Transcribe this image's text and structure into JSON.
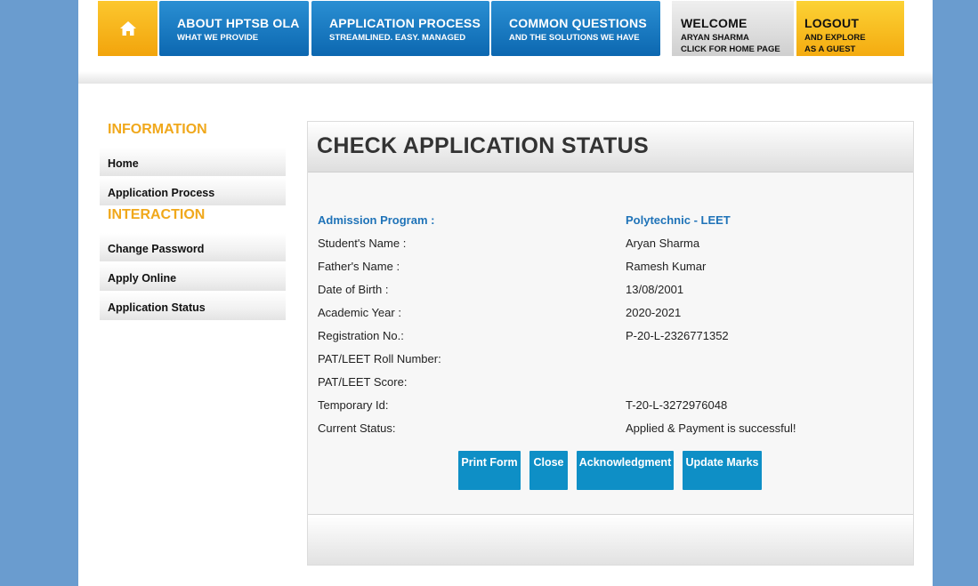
{
  "nav": {
    "about": {
      "title": "ABOUT HPTSB OLA",
      "subtitle": "WHAT WE PROVIDE"
    },
    "process": {
      "title": "APPLICATION PROCESS",
      "subtitle": "STREAMLINED. EASY. MANAGED"
    },
    "questions": {
      "title": "COMMON QUESTIONS",
      "subtitle": "AND THE SOLUTIONS WE HAVE"
    },
    "welcome": {
      "title": "WELCOME",
      "line1": "ARYAN SHARMA",
      "line2": "CLICK FOR HOME PAGE"
    },
    "logout": {
      "title": "LOGOUT",
      "line1": "AND EXPLORE",
      "line2": "AS A GUEST"
    },
    "home_icon": "home-icon"
  },
  "sidebar": {
    "information_heading": "INFORMATION",
    "information_items": [
      "Home",
      "Application Process"
    ],
    "interaction_heading": "INTERACTION",
    "interaction_items": [
      "Change Password",
      "Apply Online",
      "Application Status"
    ]
  },
  "main": {
    "title": "CHECK APPLICATION STATUS",
    "fields": [
      {
        "label": "Admission Program :",
        "value": "Polytechnic - LEET"
      },
      {
        "label": "Student's Name :",
        "value": "Aryan Sharma"
      },
      {
        "label": "Father's Name :",
        "value": "Ramesh Kumar"
      },
      {
        "label": "Date of Birth :",
        "value": "13/08/2001"
      },
      {
        "label": "Academic Year :",
        "value": "2020-2021"
      },
      {
        "label": "Registration No.:",
        "value": "P-20-L-2326771352"
      },
      {
        "label": "PAT/LEET Roll Number:",
        "value": ""
      },
      {
        "label": "PAT/LEET Score:",
        "value": ""
      },
      {
        "label": "Temporary Id:",
        "value": "T-20-L-3272976048"
      },
      {
        "label": "Current Status:",
        "value": "Applied & Payment is successful!"
      }
    ],
    "buttons": [
      "Print Form",
      "Close",
      "Acknowledgment",
      "Update Marks"
    ]
  },
  "colors": {
    "accent_orange": "#f0a81c",
    "nav_blue": "#0c67b0",
    "highlight_blue": "#1f73b8",
    "button_blue": "#0e8fc6",
    "background": "#6a9ccf"
  }
}
